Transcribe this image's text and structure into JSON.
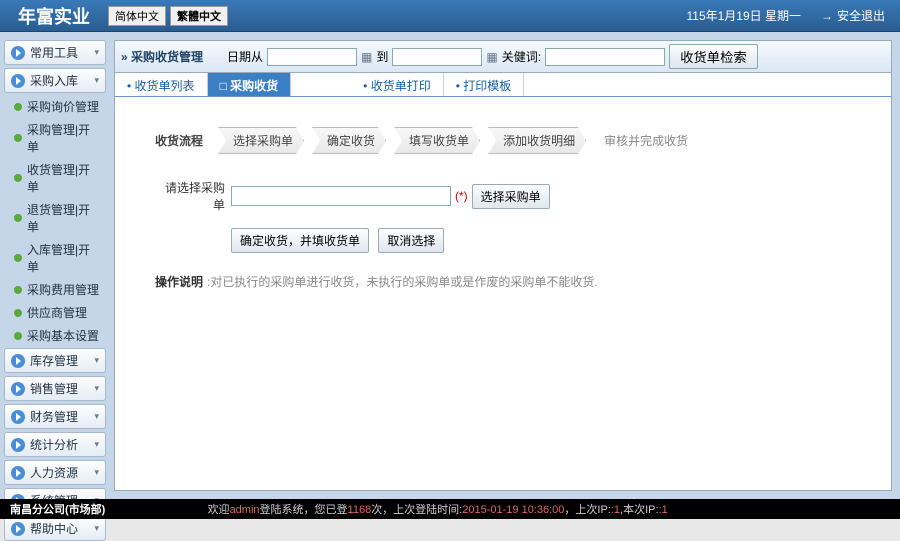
{
  "header": {
    "logo": "年富实业",
    "lang_simp": "简体中文",
    "lang_trad": "繁體中文",
    "date": "115年1月19日 星期一",
    "logout": "安全退出"
  },
  "sidebar": {
    "menus": [
      {
        "label": "常用工具",
        "expand": false
      },
      {
        "label": "采购入库",
        "expand": true
      }
    ],
    "subs": [
      "采购询价管理",
      "采购管理|开单",
      "收货管理|开单",
      "退货管理|开单",
      "入库管理|开单",
      "采购费用管理",
      "供应商管理",
      "采购基本设置"
    ],
    "menus2": [
      "库存管理",
      "销售管理",
      "财务管理",
      "统计分析",
      "人力资源",
      "系统管理",
      "帮助中心"
    ]
  },
  "toolbar": {
    "title": "采购收货管理",
    "date_from": "日期从",
    "to": "到",
    "keyword": "关健词:",
    "search": "收货单检索"
  },
  "tabs": {
    "t1": "收货单列表",
    "t2": "采购收货",
    "t3": "收货单打印",
    "t4": "打印模板"
  },
  "content": {
    "steps_label": "收货流程",
    "steps": [
      "选择采购单",
      "确定收货",
      "填写收货单",
      "添加收货明细"
    ],
    "step_final": "审核并完成收货",
    "form_label": "请选择采购单",
    "req": "(*)",
    "btn_select": "选择采购单",
    "btn_confirm": "确定收货，并填收货单",
    "btn_cancel": "取消选择",
    "desc_label": "操作说明",
    "desc_text": ":对已执行的采购单进行收货，未执行的采购单或是作废的采购单不能收货."
  },
  "footer": {
    "company": "南昌分公司(市场部)",
    "p1": "欢迎",
    "user": "admin",
    "p2": "登陆系统，您已登",
    "count": "1168",
    "p3": "次，上次登陆时间:",
    "time": "2015-01-19 10:36:00",
    "p4": "，上次IP:",
    "ip1": ":1",
    "p5": ",本次IP:",
    "ip2": ":1"
  }
}
